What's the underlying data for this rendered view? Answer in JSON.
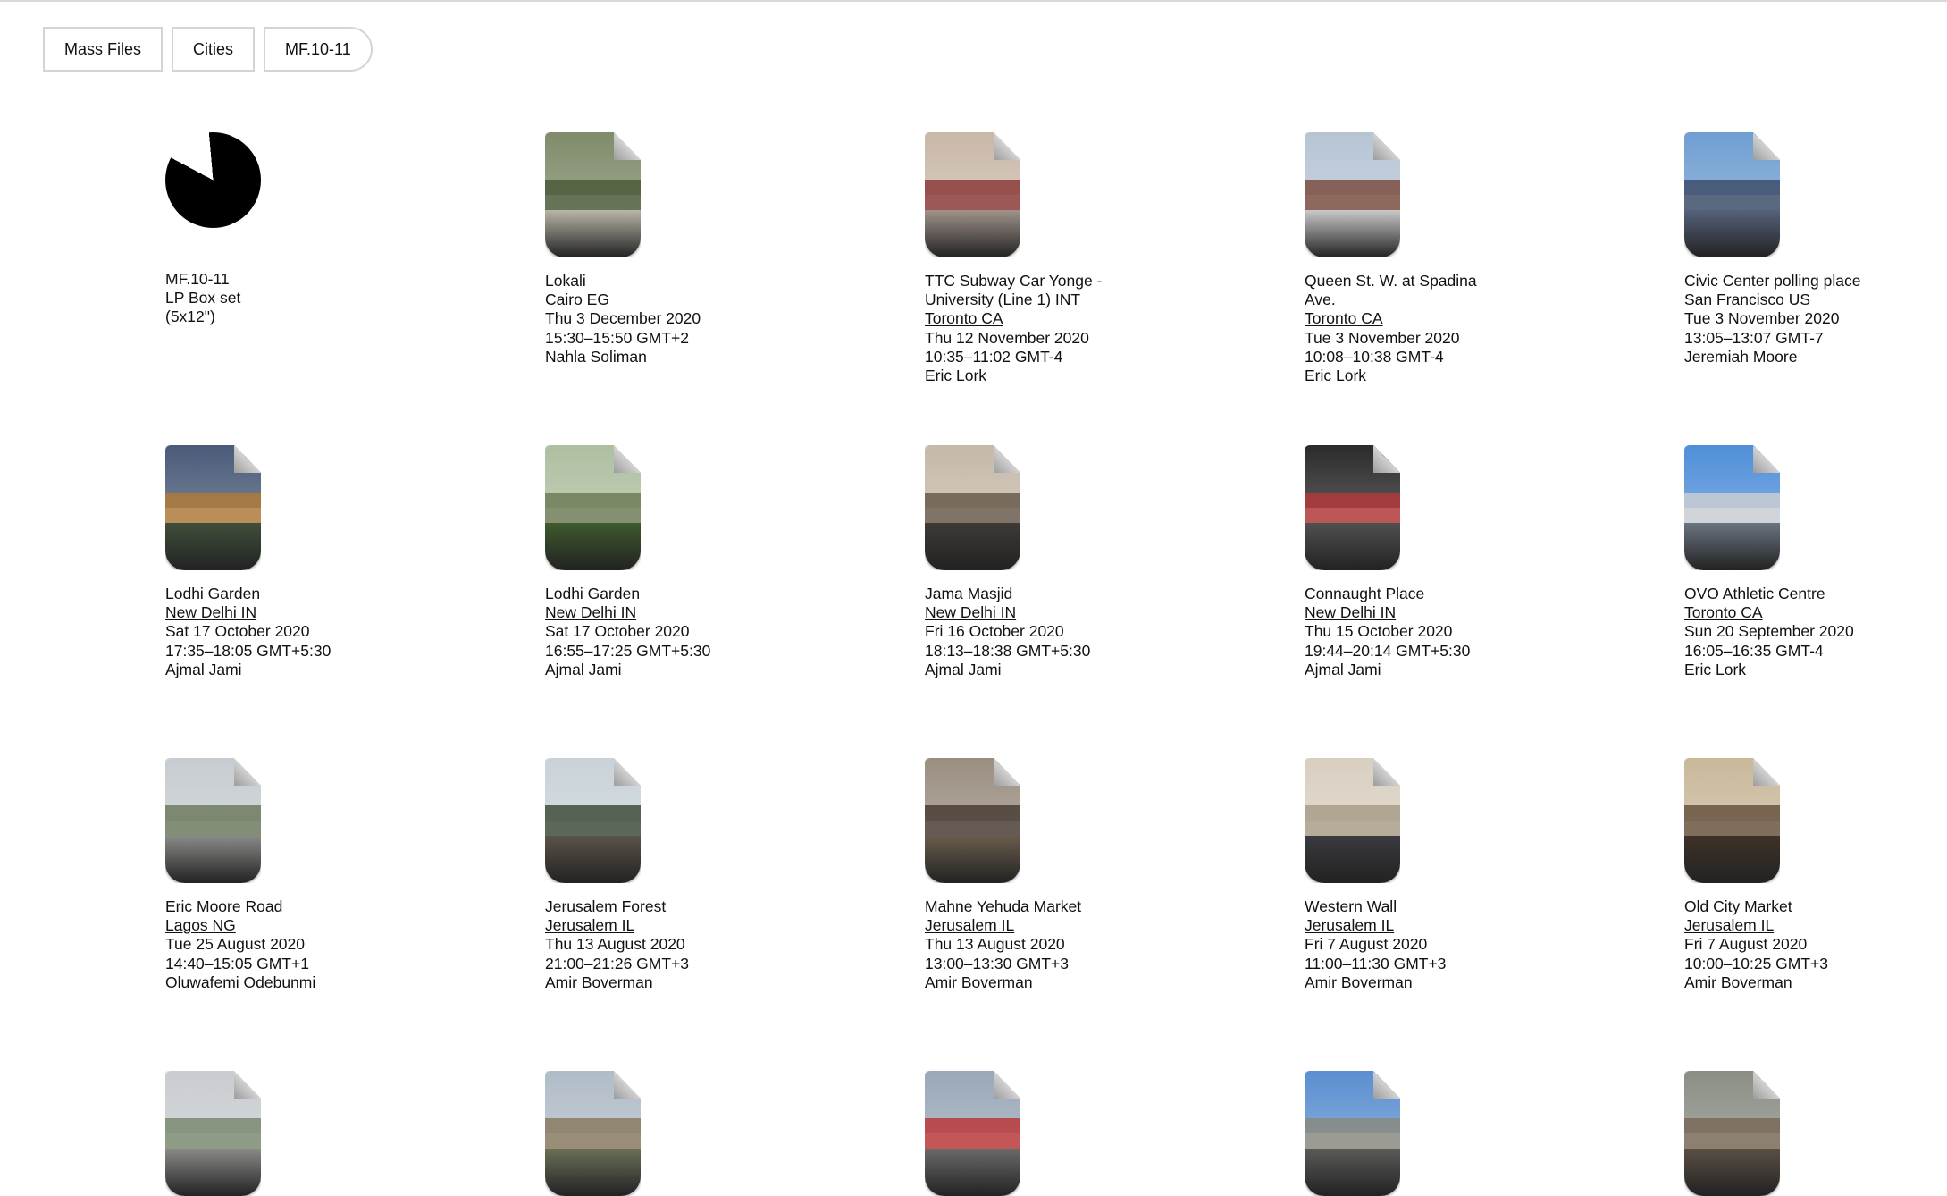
{
  "breadcrumb": [
    "Mass Files",
    "Cities",
    "MF.10-11"
  ],
  "header_item": {
    "icon": "pie-chart-icon",
    "lines": [
      "MF.10-11",
      "LP Box set",
      "(5x12\")"
    ]
  },
  "items": [
    {
      "title": "Lokali",
      "city": "Cairo EG",
      "date": "Thu 3 December 2020",
      "time": "15:30–15:50 GMT+2",
      "author": "Nahla Soliman",
      "palette": [
        "#7f8b6a",
        "#4c5a3a",
        "#b9b5a8"
      ]
    },
    {
      "title": "TTC Subway Car Yonge - University (Line 1) INT",
      "city": "Toronto CA",
      "date": "Thu 12 November 2020",
      "time": "10:35–11:02 GMT-4",
      "author": "Eric Lork",
      "palette": [
        "#c9b8a8",
        "#8b3b3a",
        "#a0928a"
      ]
    },
    {
      "title": "Queen St. W. at Spadina Ave.",
      "city": "Toronto CA",
      "date": "Tue 3 November 2020",
      "time": "10:08–10:38 GMT-4",
      "author": "Eric Lork",
      "palette": [
        "#b6c4d4",
        "#7a4e40",
        "#c9c9c9"
      ]
    },
    {
      "title": "Civic Center polling place",
      "city": "San Francisco US",
      "date": "Tue 3 November 2020",
      "time": "13:05–13:07 GMT-7",
      "author": "Jeremiah Moore",
      "palette": [
        "#6f9ed1",
        "#3d4d6a",
        "#55627a"
      ]
    },
    {
      "title": "Lodhi Garden",
      "city": "New Delhi IN",
      "date": "Sat 17 October 2020",
      "time": "17:35–18:05 GMT+5:30",
      "author": "Ajmal Jami",
      "palette": [
        "#4a5a78",
        "#b07a3a",
        "#3f4e3a"
      ]
    },
    {
      "title": "Lodhi Garden",
      "city": "New Delhi IN",
      "date": "Sat 17 October 2020",
      "time": "16:55–17:25 GMT+5:30",
      "author": "Ajmal Jami",
      "palette": [
        "#aebfa0",
        "#6e7d58",
        "#3f5a2e"
      ]
    },
    {
      "title": "Jama Masjid",
      "city": "New Delhi IN",
      "date": "Fri 16 October 2020",
      "time": "18:13–18:38 GMT+5:30",
      "author": "Ajmal Jami",
      "palette": [
        "#c5b9a8",
        "#6a5a4c",
        "#3d3a36"
      ]
    },
    {
      "title": "Connaught Place",
      "city": "New Delhi IN",
      "date": "Thu 15 October 2020",
      "time": "19:44–20:14 GMT+5:30",
      "author": "Ajmal Jami",
      "palette": [
        "#2b2b2b",
        "#b23a3a",
        "#505050"
      ]
    },
    {
      "title": "OVO Athletic Centre",
      "city": "Toronto CA",
      "date": "Sun 20 September 2020",
      "time": "16:05–16:35 GMT-4",
      "author": "Eric Lork",
      "palette": [
        "#4f8fd8",
        "#c9ccd2",
        "#6b7480"
      ]
    },
    {
      "title": "Eric Moore Road",
      "city": "Lagos NG",
      "date": "Tue 25 August 2020",
      "time": "14:40–15:05 GMT+1",
      "author": "Oluwafemi Odebunmi",
      "palette": [
        "#c7ccd0",
        "#6d7a5e",
        "#8a8a88"
      ]
    },
    {
      "title": "Jerusalem Forest",
      "city": "Jerusalem IL",
      "date": "Thu 13 August 2020",
      "time": "21:00–21:26 GMT+3",
      "author": "Amir Boverman",
      "palette": [
        "#c8d2d8",
        "#3f4e3a",
        "#5a5448"
      ]
    },
    {
      "title": "Mahne Yehuda Market",
      "city": "Jerusalem IL",
      "date": "Thu 13 August 2020",
      "time": "13:00–13:30 GMT+3",
      "author": "Amir Boverman",
      "palette": [
        "#9a8e80",
        "#4a3e36",
        "#6a5c4c"
      ]
    },
    {
      "title": "Western Wall",
      "city": "Jerusalem IL",
      "date": "Fri 7 August 2020",
      "time": "11:00–11:30 GMT+3",
      "author": "Amir Boverman",
      "palette": [
        "#d8cfc0",
        "#a89e88",
        "#3a3a40"
      ]
    },
    {
      "title": "Old City Market",
      "city": "Jerusalem IL",
      "date": "Fri 7 August 2020",
      "time": "10:00–10:25 GMT+3",
      "author": "Amir Boverman",
      "palette": [
        "#c9b89a",
        "#6a5440",
        "#3e3228"
      ]
    },
    {
      "palette": [
        "#c9ccd0",
        "#7a8a70",
        "#8a8a88"
      ]
    },
    {
      "palette": [
        "#b0bcc8",
        "#8a7a60",
        "#6a7058"
      ]
    },
    {
      "palette": [
        "#9aa8b8",
        "#b83a3a",
        "#6a6a6a"
      ]
    },
    {
      "palette": [
        "#5b8fd0",
        "#8a8a80",
        "#5a5a58"
      ]
    },
    {
      "palette": [
        "#8a8e84",
        "#7a6a58",
        "#5a5044"
      ]
    }
  ]
}
